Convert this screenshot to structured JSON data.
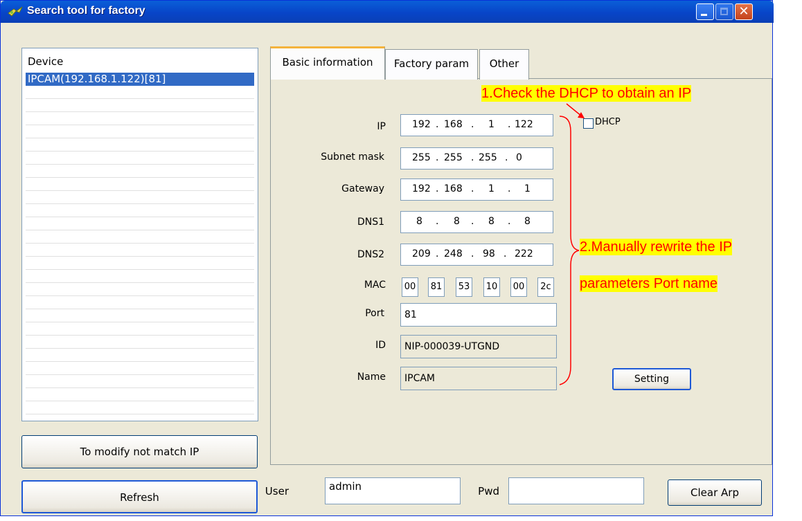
{
  "window": {
    "title": "Search tool for factory"
  },
  "device_list": {
    "header": "Device",
    "items": [
      {
        "label": "IPCAM(192.168.1.122)[81]",
        "selected": true
      }
    ]
  },
  "left_buttons": {
    "modify": "To modify not match IP",
    "refresh": "Refresh"
  },
  "tabs": [
    {
      "label": "Basic information",
      "active": true
    },
    {
      "label": "Factory param",
      "active": false
    },
    {
      "label": "Other",
      "active": false
    }
  ],
  "form": {
    "ip": {
      "label": "IP",
      "octets": [
        "192",
        "168",
        "1",
        "122"
      ]
    },
    "subnet": {
      "label": "Subnet mask",
      "octets": [
        "255",
        "255",
        "255",
        "0"
      ]
    },
    "gateway": {
      "label": "Gateway",
      "octets": [
        "192",
        "168",
        "1",
        "1"
      ]
    },
    "dns1": {
      "label": "DNS1",
      "octets": [
        "8",
        "8",
        "8",
        "8"
      ]
    },
    "dns2": {
      "label": "DNS2",
      "octets": [
        "209",
        "248",
        "98",
        "222"
      ]
    },
    "mac": {
      "label": "MAC",
      "parts": [
        "00",
        "81",
        "53",
        "10",
        "00",
        "2c"
      ]
    },
    "port": {
      "label": "Port",
      "value": "81"
    },
    "id": {
      "label": "ID",
      "value": "NIP-000039-UTGND"
    },
    "name": {
      "label": "Name",
      "value": "IPCAM"
    },
    "dhcp": {
      "label": "DHCP",
      "checked": false
    },
    "setting_button": "Setting"
  },
  "annotations": {
    "note1": "1.Check the DHCP to obtain an IP",
    "note2_line1": "2.Manually  rewrite  the  IP",
    "note2_line2": "parameters Port name",
    "color_text": "#ff0000",
    "color_highlight": "#ffff00"
  },
  "auth": {
    "user_label": "User",
    "user_value": "admin",
    "pwd_label": "Pwd",
    "pwd_value": "",
    "clear_arp": "Clear Arp"
  },
  "icons": {
    "title": "app-icon",
    "minimize": "minimize-icon",
    "maximize": "maximize-icon",
    "close": "close-icon"
  }
}
